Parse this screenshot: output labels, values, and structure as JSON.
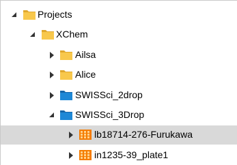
{
  "tree": {
    "items": [
      {
        "label": "Projects",
        "icon": "folder-icon",
        "expanded": true
      },
      {
        "label": "XChem",
        "icon": "folder-icon",
        "expanded": true
      },
      {
        "label": "Ailsa",
        "icon": "folder-icon",
        "expanded": false
      },
      {
        "label": "Alice",
        "icon": "folder-icon",
        "expanded": false
      },
      {
        "label": "SWISSci_2drop",
        "icon": "plate-type-icon",
        "expanded": false
      },
      {
        "label": "SWISSci_3Drop",
        "icon": "plate-type-icon",
        "expanded": true
      },
      {
        "label": "lb18714-276-Furukawa",
        "icon": "plate-grid-icon",
        "expanded": false,
        "selected": true
      },
      {
        "label": "in1235-39_plate1",
        "icon": "plate-grid-icon",
        "expanded": false
      }
    ]
  },
  "colors": {
    "folder": "#f8c84c",
    "folder_dark": "#e0a82e",
    "plate_type": "#1e88d6",
    "plate_grid": "#f57c00",
    "selection": "#d9d9d9"
  }
}
